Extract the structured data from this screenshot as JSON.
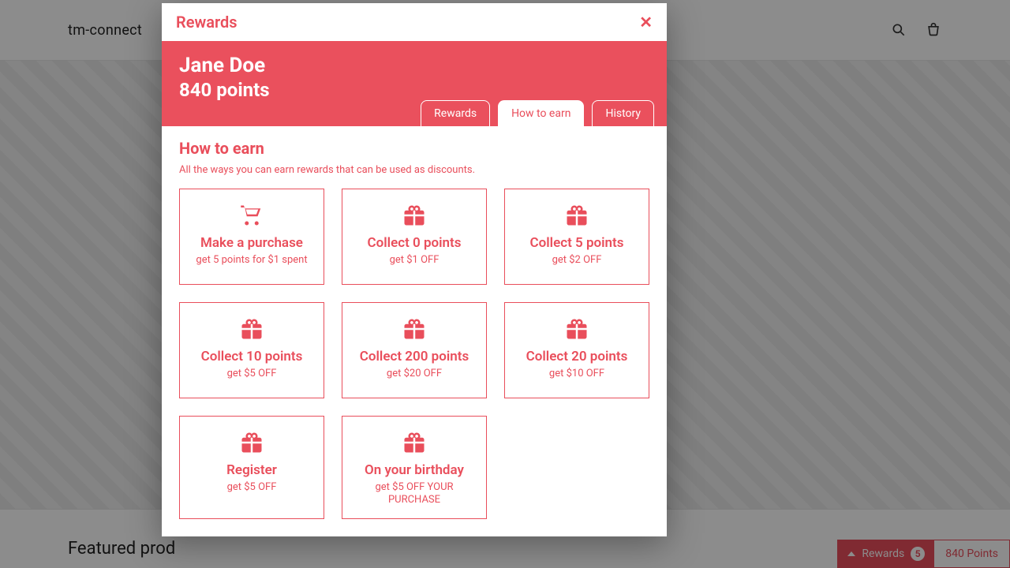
{
  "site": {
    "brand": "tm-connect",
    "featured_heading": "Featured prod"
  },
  "footer_widget": {
    "label": "Rewards",
    "badge": "5",
    "points_text": "840 Points"
  },
  "modal": {
    "title": "Rewards",
    "user_name": "Jane Doe",
    "points_line": "840 points",
    "tabs": {
      "rewards": "Rewards",
      "how": "How to earn",
      "history": "History"
    },
    "section_title": "How to earn",
    "section_sub": "All the ways you can earn rewards that can be used as discounts.",
    "cards": [
      {
        "icon": "cart",
        "title": "Make a purchase",
        "desc": "get 5 points for $1 spent"
      },
      {
        "icon": "gift",
        "title": "Collect 0 points",
        "desc": "get $1 OFF"
      },
      {
        "icon": "gift",
        "title": "Collect 5 points",
        "desc": "get $2 OFF"
      },
      {
        "icon": "gift",
        "title": "Collect 10 points",
        "desc": "get $5 OFF"
      },
      {
        "icon": "gift",
        "title": "Collect 200 points",
        "desc": "get $20 OFF"
      },
      {
        "icon": "gift",
        "title": "Collect 20 points",
        "desc": "get $10 OFF"
      },
      {
        "icon": "gift",
        "title": "Register",
        "desc": "get $5 OFF"
      },
      {
        "icon": "gift",
        "title": "On your birthday",
        "desc": "get $5 OFF YOUR PURCHASE"
      }
    ]
  }
}
